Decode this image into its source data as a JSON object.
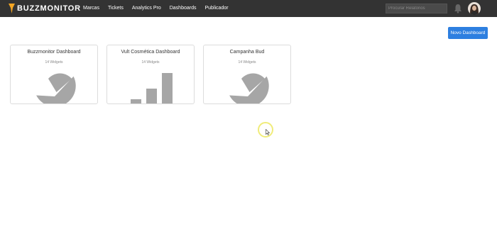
{
  "header": {
    "logo_text": "BUZZMONITOR",
    "nav": [
      {
        "label": "Marcas"
      },
      {
        "label": "Tickets"
      },
      {
        "label": "Analytics Pro"
      },
      {
        "label": "Dashboards"
      },
      {
        "label": "Publicador"
      }
    ],
    "search_placeholder": "Procurar Relatórios",
    "icons": {
      "bell": "bell-icon",
      "avatar": "user-avatar"
    }
  },
  "main": {
    "new_button_label": "Novo Dashboard",
    "dashboards": [
      {
        "title": "Buzzmonitor Dashboard",
        "subtitle": "14 Widgets",
        "preview": "pie-chart-icon"
      },
      {
        "title": "Vult Cosmética Dashboard",
        "subtitle": "14 Widgets",
        "preview": "bar-chart-icon"
      },
      {
        "title": "Campanha Bud",
        "subtitle": "14 Widgets",
        "preview": "pie-chart-icon"
      }
    ]
  },
  "colors": {
    "topbar": "#333333",
    "accent": "#2d7fe0",
    "preview_gray": "#a6a6a6",
    "logo_orange": "#f5a623"
  }
}
